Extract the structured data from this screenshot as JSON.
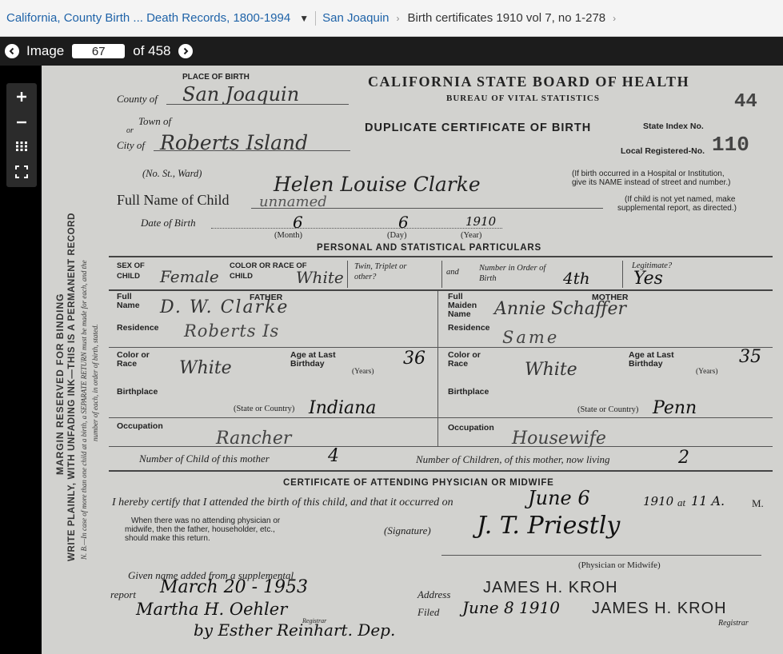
{
  "breadcrumb": {
    "collection": "California, County Birth ... Death Records, 1800-1994",
    "county": "San Joaquin",
    "volume": "Birth certificates 1910 vol 7, no 1-278"
  },
  "image_nav": {
    "label": "Image",
    "number": "67",
    "of_label": "of 458"
  },
  "icons": {
    "zoom_in": "plus-icon",
    "zoom_out": "minus-icon",
    "grid": "grid-icon",
    "fullscreen": "fullscreen-icon",
    "prev": "chevron-left-icon",
    "next": "chevron-right-icon"
  },
  "certificate": {
    "margin_line1": "MARGIN RESERVED FOR BINDING",
    "margin_line2": "WRITE PLAINLY, WITH UNFADING INK—THIS IS A PERMANENT RECORD",
    "margin_line3": "N. B.—In case of more than one child at a birth, a SEPARATE RETURN must be made for each, and the",
    "margin_line4": "number of each, in order of birth, stated.",
    "place_of_birth": "PLACE OF BIRTH",
    "county_label": "County of",
    "county_value": "San Joaquin",
    "town_label": "Town of",
    "or_label": "or",
    "city_label": "City of",
    "city_value": "Roberts Island",
    "board": "CALIFORNIA STATE BOARD OF HEALTH",
    "bureau": "BUREAU OF VITAL STATISTICS",
    "cert_number": "44",
    "title": "DUPLICATE CERTIFICATE OF BIRTH",
    "state_index": "State Index No.",
    "local_reg": "Local Registered-No.",
    "local_reg_value": "110",
    "no_st_ward": "(No.                                 St.,                             Ward)",
    "hospital_note1": "(If birth occurred in a Hospital or Institution,",
    "hospital_note2": "give its NAME instead of street and number.)",
    "full_name_label": "Full Name of Child",
    "full_name_value": "Helen Louise Clarke",
    "unnamed_value": "unnamed",
    "unnamed_note1": "(If child is not yet named, make",
    "unnamed_note2": "supplemental report, as directed.)",
    "dob_label": "Date of Birth",
    "dob_month": "6",
    "dob_day": "6",
    "dob_year": "1910",
    "month_label": "(Month)",
    "day_label": "(Day)",
    "year_label": "(Year)",
    "personal": "PERSONAL AND STATISTICAL PARTICULARS",
    "sex_label": "SEX OF CHILD",
    "sex_value": "Female",
    "color_race_child": "COLOR OR RACE OF CHILD",
    "color_child_value": "White",
    "twin_label": "Twin, Triplet or other?",
    "and_label": "and",
    "number_order": "Number in Order of Birth",
    "number_order_value": "4th",
    "legitimate": "Legitimate?",
    "legitimate_value": "Yes",
    "father_header": "FATHER",
    "mother_header": "MOTHER",
    "full_name_small": "Full Name",
    "father_name": "D. W. Clarke",
    "full_maiden_name": "Full Maiden Name",
    "mother_name": "Annie Schaffer",
    "residence": "Residence",
    "father_residence": "Roberts Is",
    "mother_residence": "Same",
    "color_race": "Color or Race",
    "father_color": "White",
    "mother_color": "White",
    "age_last_birthday": "Age at Last Birthday",
    "years_label": "(Years)",
    "father_age": "36",
    "mother_age": "35",
    "birthplace": "Birthplace",
    "state_country": "(State or Country)",
    "father_birthplace": "Indiana",
    "mother_birthplace": "Penn",
    "occupation": "Occupation",
    "father_occupation": "Rancher",
    "mother_occupation": "Housewife",
    "child_of_mother": "Number of Child of this mother",
    "child_of_mother_value": "4",
    "children_living": "Number of Children, of this mother, now living",
    "children_living_value": "2",
    "cert_physician": "CERTIFICATE OF ATTENDING PHYSICIAN OR MIDWIFE",
    "certify_text": "I hereby certify that I attended the birth of this child, and that it occurred on",
    "certify_date": "June 6",
    "certify_year": "1910",
    "at_label": "at",
    "certify_time": "11 A.",
    "m_label": "M.",
    "no_physician1": "When there was no attending physician or",
    "no_physician2": "midwife, then the father, householder, etc.,",
    "no_physician3": "should make this return.",
    "signature_label": "(Signature)",
    "signature_value": "J. T. Priestly",
    "physician_label": "(Physician or Midwife)",
    "given_name_added": "Given name added from a supplemental",
    "report_label": "report",
    "report_value": "March 20 - 1953",
    "signed_registrar": "Martha H. Oehler",
    "registrar_small": "Registrar",
    "deputy_value": "by Esther Reinhart. Dep.",
    "address_label": "Address",
    "address_value": "JAMES H. KROH",
    "filed_label": "Filed",
    "filed_value": "June 8 1910",
    "registrar_stamp": "JAMES H. KROH",
    "registrar_label": "Registrar"
  }
}
